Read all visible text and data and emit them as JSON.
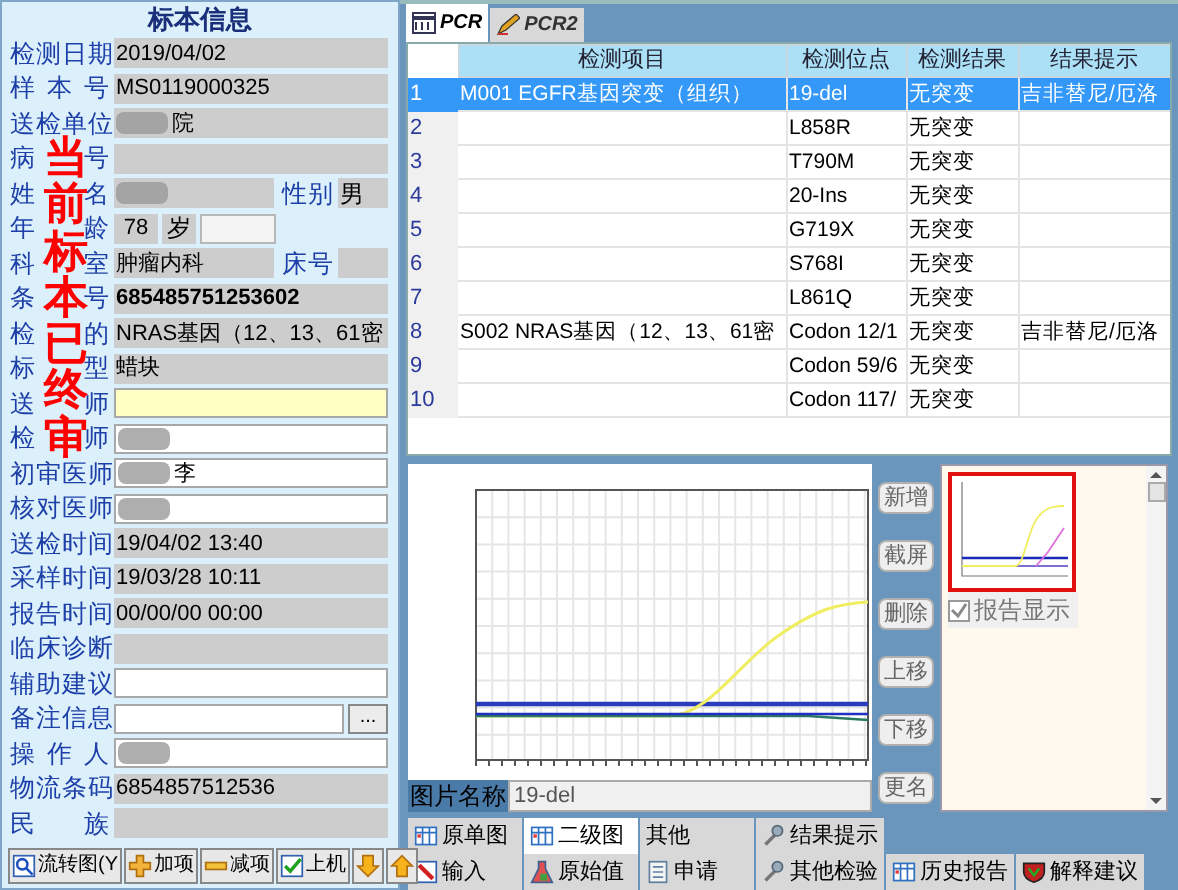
{
  "sample_info": {
    "title": "标本信息",
    "stamp": "当前标本已终审",
    "rows": [
      {
        "kind": "plain",
        "label": "检测日期",
        "value": "2019/04/02",
        "readonly": true,
        "focused": false,
        "redacted": false
      },
      {
        "kind": "plain",
        "label": "样 本 号",
        "value": "MS0119000325",
        "readonly": true,
        "focused": false,
        "redacted": false
      },
      {
        "kind": "plain",
        "label": "送检单位",
        "value": "院",
        "readonly": true,
        "focused": false,
        "redacted": true
      },
      {
        "kind": "plain",
        "label_fragments": [
          "病",
          "号"
        ],
        "readonly": true,
        "focused": false,
        "redacted": false
      },
      {
        "kind": "with_side",
        "label_fragments": [
          "姓",
          "名"
        ],
        "readonly": true,
        "focused": false,
        "redacted": true,
        "side_label": "性别",
        "side_value": "男"
      },
      {
        "kind": "age",
        "label_fragments": [
          "年",
          "龄"
        ],
        "value": "78",
        "unit": "岁",
        "readonly": true,
        "focused": false,
        "redacted": false
      },
      {
        "kind": "with_side",
        "label_fragments": [
          "科",
          "室"
        ],
        "value": "肿瘤内科",
        "readonly": true,
        "focused": false,
        "redacted": false,
        "side_label": "床号"
      },
      {
        "kind": "barcode",
        "label_fragments": [
          "条",
          "号"
        ],
        "value": "685485751253602",
        "readonly": true,
        "focused": false,
        "redacted": false
      },
      {
        "kind": "plain",
        "label_fragments": [
          "检",
          "的"
        ],
        "value": "NRAS基因（12、13、61密",
        "readonly": true,
        "focused": false,
        "redacted": false
      },
      {
        "kind": "plain",
        "label_fragments": [
          "标",
          "型"
        ],
        "value": "蜡块",
        "readonly": true,
        "focused": false,
        "redacted": false
      },
      {
        "kind": "plain",
        "label_fragments": [
          "送",
          "师"
        ],
        "readonly": false,
        "focused": true,
        "redacted": false
      },
      {
        "kind": "plain",
        "label_fragments": [
          "检",
          "师"
        ],
        "readonly": false,
        "focused": false,
        "redacted": true
      },
      {
        "kind": "plain",
        "label": "初审医师",
        "value": "李",
        "readonly": false,
        "focused": false,
        "redacted": true
      },
      {
        "kind": "plain",
        "label": "核对医师",
        "readonly": false,
        "focused": false,
        "redacted": true
      },
      {
        "kind": "plain",
        "label": "送检时间",
        "value": "19/04/02 13:40",
        "readonly": true,
        "focused": false,
        "redacted": false
      },
      {
        "kind": "plain",
        "label": "采样时间",
        "value": "19/03/28 10:11",
        "readonly": true,
        "focused": false,
        "redacted": false
      },
      {
        "kind": "plain",
        "label": "报告时间",
        "value": "00/00/00 00:00",
        "readonly": true,
        "focused": false,
        "redacted": false
      },
      {
        "kind": "plain",
        "label": "临床诊断",
        "readonly": true,
        "focused": false,
        "redacted": false
      },
      {
        "kind": "plain",
        "label": "辅助建议",
        "readonly": false,
        "focused": false,
        "redacted": false
      },
      {
        "kind": "note",
        "label": "备注信息",
        "readonly": false,
        "focused": false,
        "redacted": false,
        "button": "..."
      },
      {
        "kind": "plain",
        "label": "操 作 人",
        "readonly": false,
        "focused": false,
        "redacted": true
      },
      {
        "kind": "plain",
        "label": "物流条码",
        "value": "6854857512536",
        "readonly": true,
        "focused": false,
        "redacted": false
      },
      {
        "kind": "plain",
        "label": "民 族",
        "readonly": true,
        "focused": false,
        "redacted": false
      }
    ],
    "buttons": [
      "流转图(Y",
      "加项",
      "减项",
      "上机"
    ]
  },
  "tabs": [
    {
      "label": "PCR",
      "selected": true
    },
    {
      "label": "PCR2",
      "selected": false
    }
  ],
  "table": {
    "columns": [
      "检测项目",
      "检测位点",
      "检测结果",
      "结果提示"
    ],
    "rows": [
      {
        "number": "1",
        "item": "M001 EGFR基因突变（组织）",
        "site": "19-del",
        "result": "无突变",
        "hint": "吉非替尼/厄洛",
        "selected": true
      },
      {
        "number": "2",
        "site": "L858R",
        "result": "无突变",
        "selected": false
      },
      {
        "number": "3",
        "site": "T790M",
        "result": "无突变",
        "selected": false
      },
      {
        "number": "4",
        "site": "20-Ins",
        "result": "无突变",
        "selected": false
      },
      {
        "number": "5",
        "site": "G719X",
        "result": "无突变",
        "selected": false
      },
      {
        "number": "6",
        "site": "S768I",
        "result": "无突变",
        "selected": false
      },
      {
        "number": "7",
        "site": "L861Q",
        "result": "无突变",
        "selected": false
      },
      {
        "number": "8",
        "item": "S002 NRAS基因（12、13、61密",
        "site": "Codon 12/1",
        "result": "无突变",
        "hint": "吉非替尼/厄洛",
        "selected": false
      },
      {
        "number": "9",
        "site": "Codon 59/6",
        "result": "无突变",
        "selected": false
      },
      {
        "number": "10",
        "site": "Codon 117/",
        "result": "无突变",
        "selected": false
      }
    ]
  },
  "image_panel": {
    "name_label": "图片名称",
    "name_value": "19-del",
    "buttons": [
      "新增",
      "截屏",
      "删除",
      "上移",
      "下移",
      "更名"
    ],
    "report_checkbox": {
      "label": "报告显示",
      "checked": true,
      "disabled": true
    }
  },
  "bottom_tabs": [
    [
      {
        "label": "原单图",
        "selected": false
      },
      {
        "label": "二级图",
        "selected": true
      },
      {
        "label": "其他",
        "selected": false
      },
      {
        "label": "结果提示",
        "selected": false
      }
    ],
    [
      {
        "label": "输入",
        "selected": false
      },
      {
        "label": "原始值",
        "selected": false
      },
      {
        "label": "申请",
        "selected": false
      },
      {
        "label": "其他检验",
        "selected": false
      },
      {
        "label": "历史报告",
        "selected": false
      },
      {
        "label": "解释建议",
        "selected": false
      }
    ]
  ]
}
